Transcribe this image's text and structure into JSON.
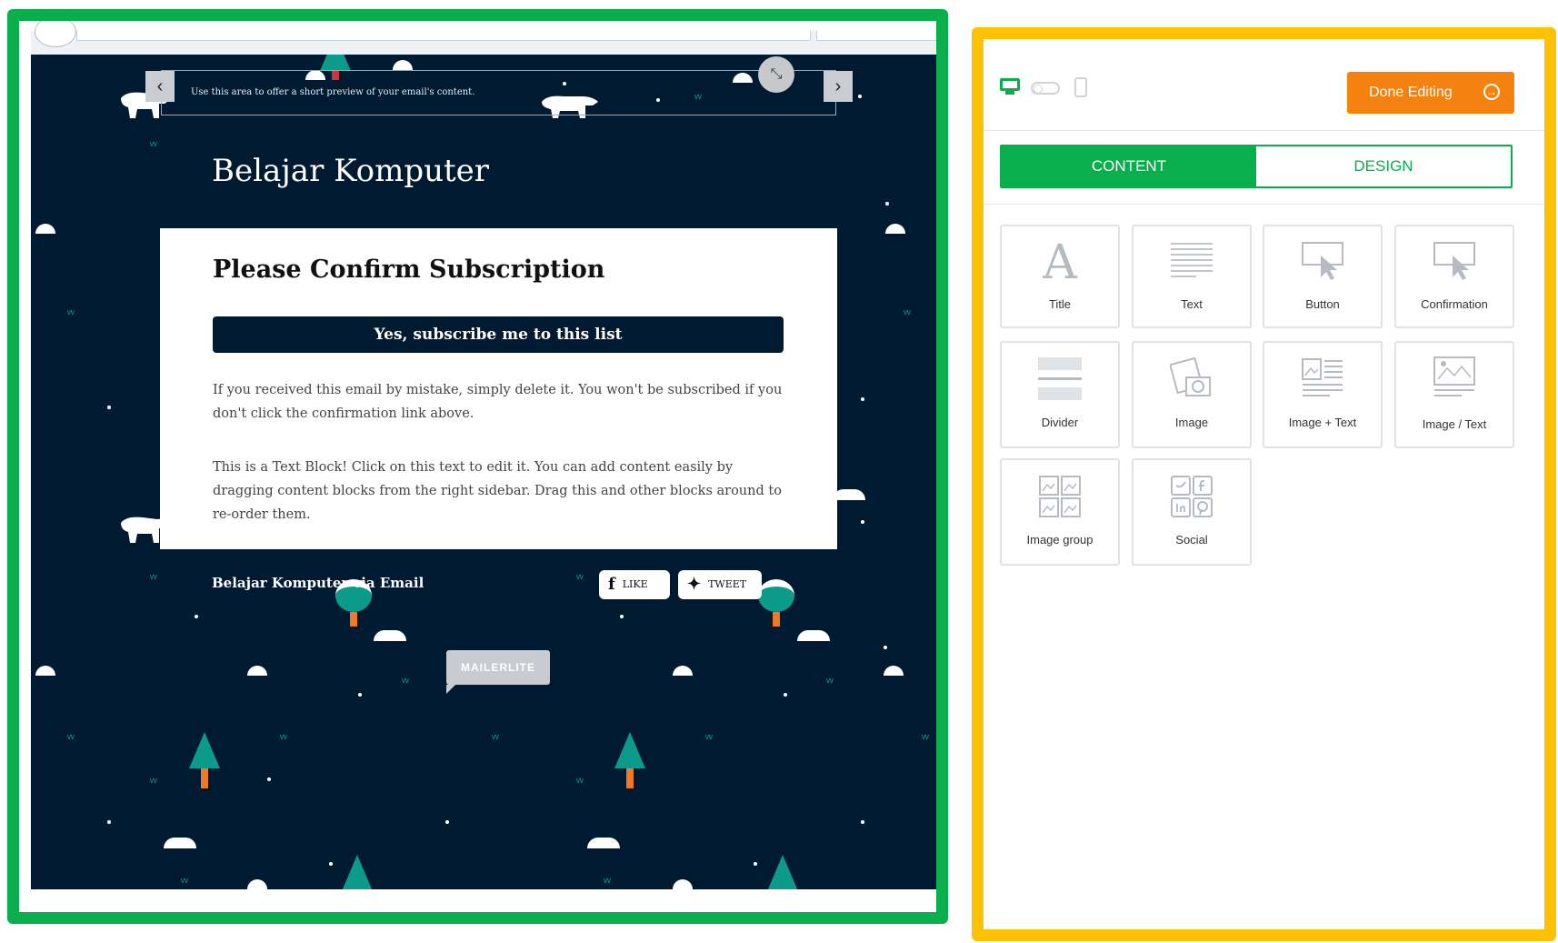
{
  "email": {
    "preview_text": "Use this area to offer a short preview of your email's content.",
    "brand_title": "Belajar Komputer",
    "card_title": "Please Confirm Subscription",
    "subscribe_button": "Yes, subscribe me to this list",
    "paragraph_1": "If you received this email by mistake, simply delete it. You won't be subscribed if you don't click the confirmation link above.",
    "paragraph_2": "This is a Text Block! Click on this text to edit it. You can add content easily by dragging content blocks from the right sidebar. Drag this and other blocks around to re-order them.",
    "footer_name": "Belajar Komputer via Email",
    "like_label": "LIKE",
    "tweet_label": "TWEET",
    "badge": "MAILERLITE",
    "background_color": "#001b31"
  },
  "editor": {
    "done_button": "Done Editing",
    "tabs": [
      "CONTENT",
      "DESIGN"
    ],
    "active_tab": "CONTENT",
    "blocks": [
      {
        "label": "Title",
        "icon": "title-icon"
      },
      {
        "label": "Text",
        "icon": "text-icon"
      },
      {
        "label": "Button",
        "icon": "button-icon"
      },
      {
        "label": "Confirmation",
        "icon": "confirmation-icon"
      },
      {
        "label": "Divider",
        "icon": "divider-icon"
      },
      {
        "label": "Image",
        "icon": "image-icon"
      },
      {
        "label": "Image + Text",
        "icon": "image-text-icon"
      },
      {
        "label": "Image / Text",
        "icon": "image-over-text-icon"
      },
      {
        "label": "Image group",
        "icon": "image-group-icon"
      },
      {
        "label": "Social",
        "icon": "social-icon"
      }
    ],
    "accent_color": "#0aae4c",
    "done_color": "#f5820f"
  },
  "highlights": {
    "left_frame_color": "#0aae4c",
    "right_frame_color": "#fdc103"
  }
}
